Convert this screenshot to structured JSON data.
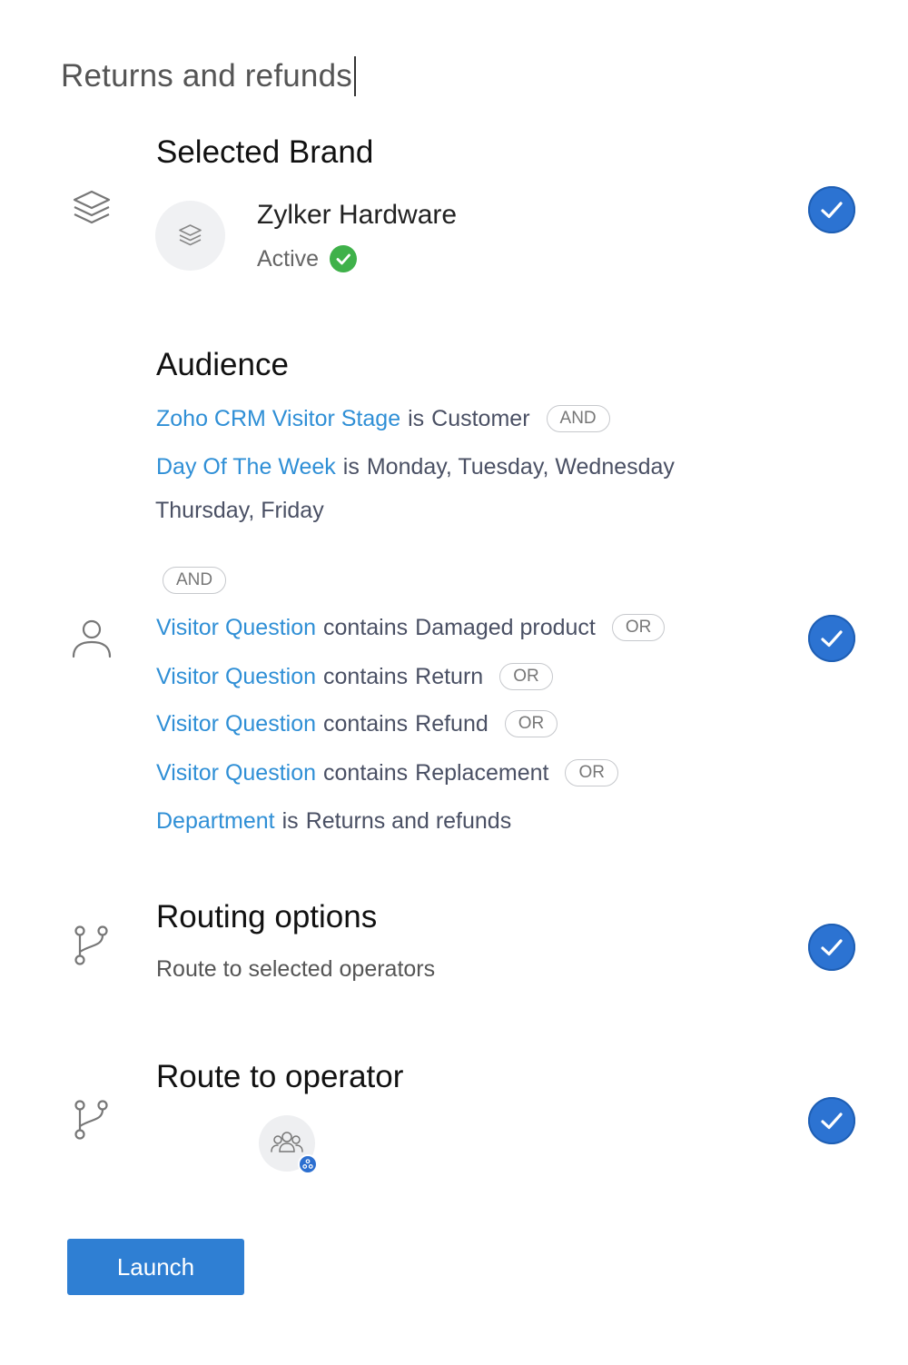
{
  "page": {
    "title": "Returns and refunds"
  },
  "brand_section": {
    "heading": "Selected Brand",
    "brand_name": "Zylker Hardware",
    "status": "Active",
    "icon": "layers-icon"
  },
  "audience_section": {
    "heading": "Audience",
    "icon": "user-icon",
    "conditions": [
      {
        "field": "Zoho CRM Visitor Stage",
        "operator": "is",
        "value": "Customer",
        "join": "AND"
      },
      {
        "field": "Day Of The Week",
        "operator": "is",
        "value": "Monday, Tuesday, Wednesday",
        "value_continued": "Thursday, Friday"
      },
      {
        "group_join": "AND"
      },
      {
        "field": "Visitor Question",
        "operator": "contains",
        "value": "Damaged product",
        "join": "OR"
      },
      {
        "field": "Visitor Question",
        "operator": "contains",
        "value": "Return",
        "join": "OR"
      },
      {
        "field": "Visitor Question",
        "operator": "contains",
        "value": "Refund",
        "join": "OR"
      },
      {
        "field": "Visitor Question",
        "operator": "contains",
        "value": "Replacement",
        "join": "OR"
      },
      {
        "field": "Department",
        "operator": "is",
        "value": "Returns and refunds"
      }
    ]
  },
  "routing_section": {
    "heading": "Routing options",
    "description": "Route to selected operators",
    "icon": "branch-icon"
  },
  "operator_section": {
    "heading": "Route to operator",
    "icon": "branch-icon",
    "avatar_icon": "group-icon",
    "badge_icon": "share-icon"
  },
  "actions": {
    "launch_label": "Launch"
  },
  "colors": {
    "accent": "#2f7fd3",
    "check": "#2c73d2",
    "field_link": "#2f8fd6",
    "active_green": "#3fb14a"
  }
}
